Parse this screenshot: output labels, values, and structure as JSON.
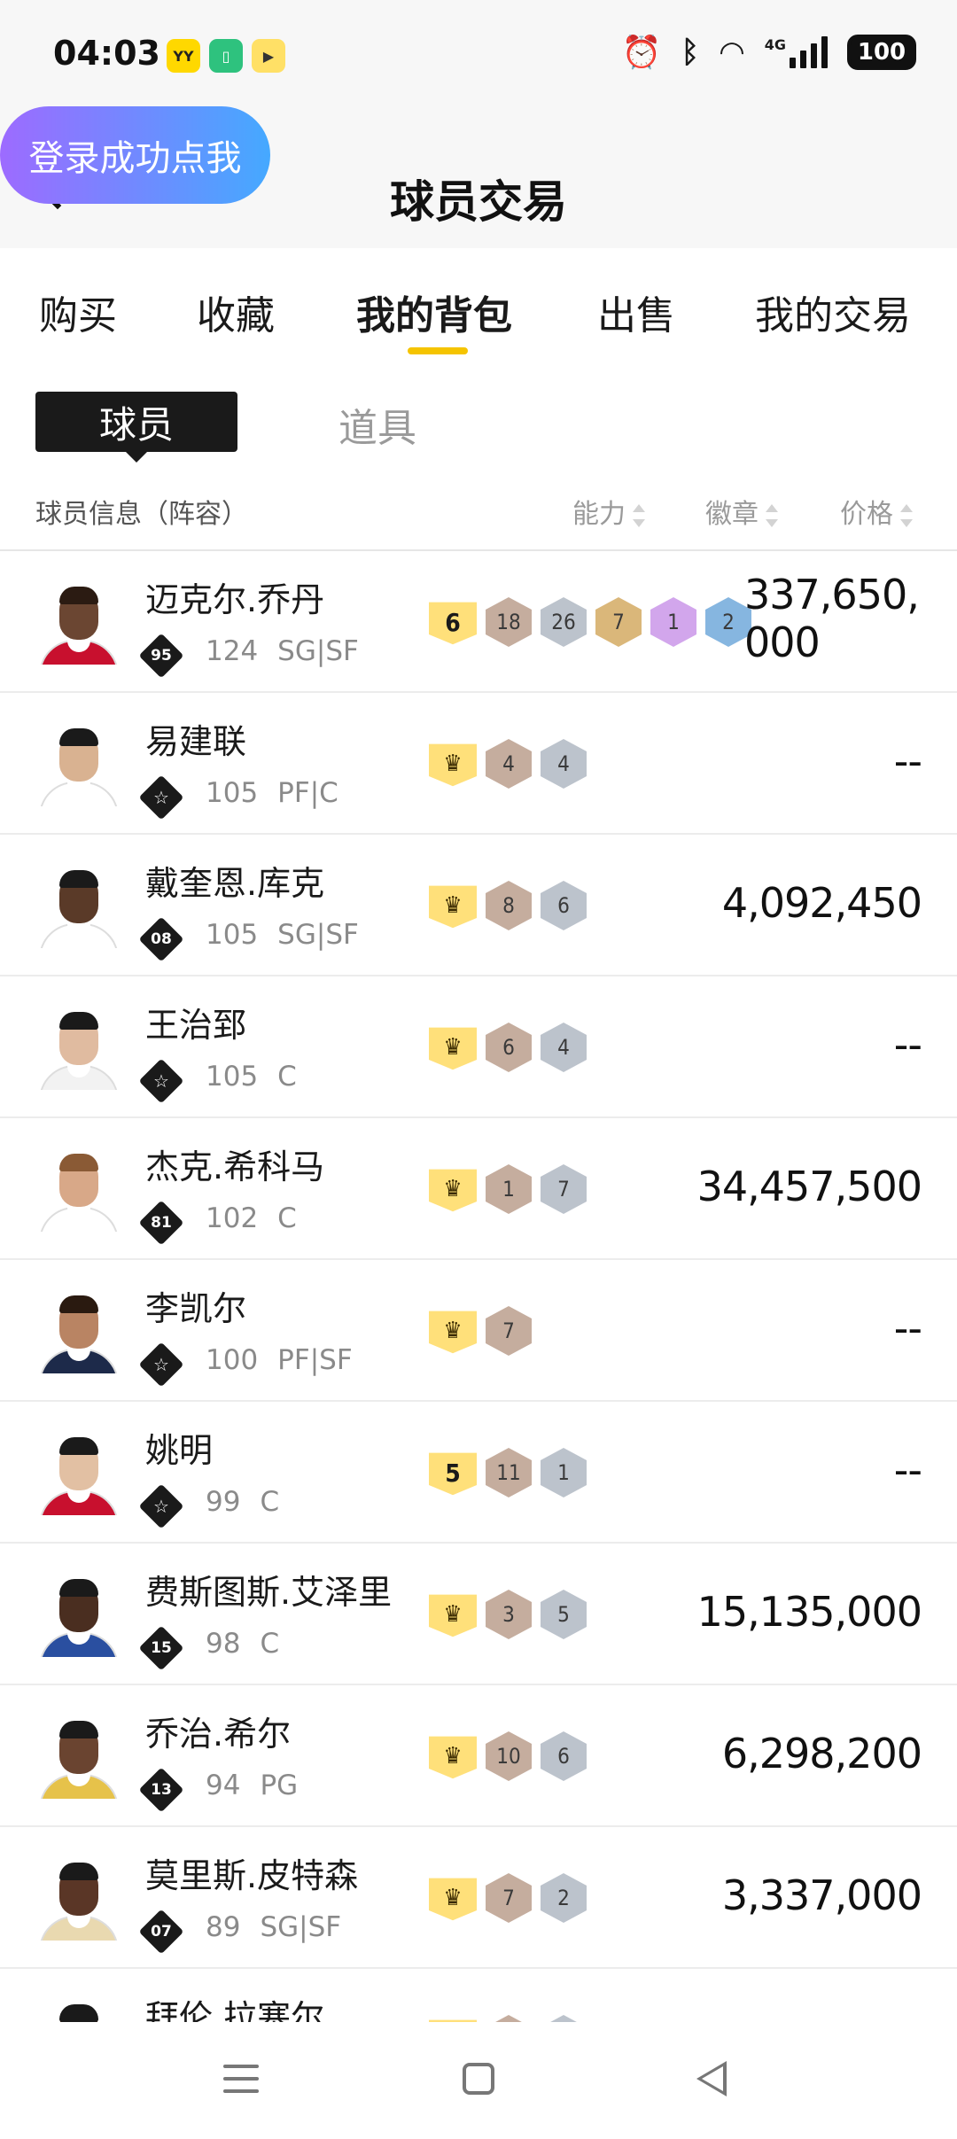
{
  "status": {
    "time": "04:03",
    "app_icons": [
      "yy-icon",
      "battery-app-icon",
      "tv-app-icon"
    ],
    "network": "4G",
    "battery": "100"
  },
  "header": {
    "title": "球员交易",
    "login_prompt": "登录成功点我"
  },
  "tabs": [
    "购买",
    "收藏",
    "我的背包",
    "出售",
    "我的交易"
  ],
  "active_tab": "我的背包",
  "subtabs": {
    "active": "球员",
    "other": "道具"
  },
  "columns": {
    "info": "球员信息（阵容）",
    "ability": "能力",
    "badge": "徽章",
    "price": "价格"
  },
  "players": [
    {
      "name": "迈克尔.乔丹",
      "badge": "95",
      "rating": "124",
      "pos": "SG|SF",
      "level": "6",
      "badges": [
        {
          "v": "18",
          "c": "bronze"
        },
        {
          "v": "26",
          "c": "silver"
        },
        {
          "v": "7",
          "c": "goldb"
        },
        {
          "v": "1",
          "c": "purple"
        },
        {
          "v": "2",
          "c": "blue"
        }
      ],
      "price": "337,650,000",
      "skin": "#6b4632",
      "hair": "#2b1b12",
      "jersey": "#c8102e"
    },
    {
      "name": "易建联",
      "badge": "☆",
      "rating": "105",
      "pos": "PF|C",
      "level": "♛",
      "badges": [
        {
          "v": "4",
          "c": "bronze"
        },
        {
          "v": "4",
          "c": "silver"
        }
      ],
      "price": "--",
      "skin": "#d9b291",
      "hair": "#1a1a1a",
      "jersey": "#ffffff"
    },
    {
      "name": "戴奎恩.库克",
      "badge": "08",
      "rating": "105",
      "pos": "SG|SF",
      "level": "♛",
      "badges": [
        {
          "v": "8",
          "c": "bronze"
        },
        {
          "v": "6",
          "c": "silver"
        }
      ],
      "price": "4,092,450",
      "skin": "#5a3a28",
      "hair": "#1a1a1a",
      "jersey": "#ffffff"
    },
    {
      "name": "王治郅",
      "badge": "☆",
      "rating": "105",
      "pos": "C",
      "level": "♛",
      "badges": [
        {
          "v": "6",
          "c": "bronze"
        },
        {
          "v": "4",
          "c": "silver"
        }
      ],
      "price": "--",
      "skin": "#e0bba0",
      "hair": "#1a1a1a",
      "jersey": "#f2f2f2"
    },
    {
      "name": "杰克.希科马",
      "badge": "81",
      "rating": "102",
      "pos": "C",
      "level": "♛",
      "badges": [
        {
          "v": "1",
          "c": "bronze"
        },
        {
          "v": "7",
          "c": "silver"
        }
      ],
      "price": "34,457,500",
      "skin": "#d8a888",
      "hair": "#8a5a35",
      "jersey": "#ffffff"
    },
    {
      "name": "李凯尔",
      "badge": "☆",
      "rating": "100",
      "pos": "PF|SF",
      "level": "♛",
      "badges": [
        {
          "v": "7",
          "c": "bronze"
        }
      ],
      "price": "--",
      "skin": "#b98463",
      "hair": "#2a1a10",
      "jersey": "#1d2a4a"
    },
    {
      "name": "姚明",
      "badge": "☆",
      "rating": "99",
      "pos": "C",
      "level": "5",
      "badges": [
        {
          "v": "11",
          "c": "bronze"
        },
        {
          "v": "1",
          "c": "silver"
        }
      ],
      "price": "--",
      "skin": "#e2c0a3",
      "hair": "#1a1a1a",
      "jersey": "#c8102e"
    },
    {
      "name": "费斯图斯.艾泽里",
      "badge": "15",
      "rating": "98",
      "pos": "C",
      "level": "♛",
      "badges": [
        {
          "v": "3",
          "c": "bronze"
        },
        {
          "v": "5",
          "c": "silver"
        }
      ],
      "price": "15,135,000",
      "skin": "#4a2e20",
      "hair": "#1a1a1a",
      "jersey": "#2a4fa0"
    },
    {
      "name": "乔治.希尔",
      "badge": "13",
      "rating": "94",
      "pos": "PG",
      "level": "♛",
      "badges": [
        {
          "v": "10",
          "c": "bronze"
        },
        {
          "v": "6",
          "c": "silver"
        }
      ],
      "price": "6,298,200",
      "skin": "#6a4430",
      "hair": "#1a1a1a",
      "jersey": "#e6c24a"
    },
    {
      "name": "莫里斯.皮特森",
      "badge": "07",
      "rating": "89",
      "pos": "SG|SF",
      "level": "♛",
      "badges": [
        {
          "v": "7",
          "c": "bronze"
        },
        {
          "v": "2",
          "c": "silver"
        }
      ],
      "price": "3,337,000",
      "skin": "#5a3626",
      "hair": "#1a1a1a",
      "jersey": "#e9d9b0"
    },
    {
      "name": "拜伦.拉塞尔",
      "badge": "☆",
      "rating": "",
      "pos": "",
      "level": "♛",
      "badges": [
        {
          "v": "",
          "c": "bronze"
        },
        {
          "v": "",
          "c": "silver"
        }
      ],
      "price": "",
      "skin": "#5a3626",
      "hair": "#1a1a1a",
      "jersey": "#ffffff"
    }
  ]
}
